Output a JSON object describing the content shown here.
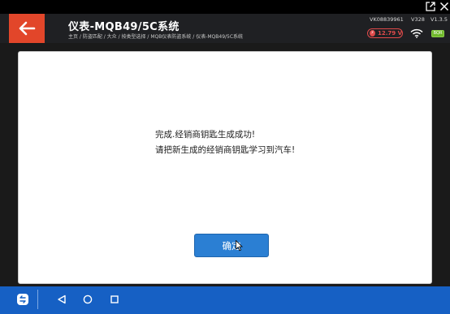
{
  "window": {
    "share_icon": "external-link-icon",
    "close_icon": "close-icon"
  },
  "header": {
    "title": "仪表-MQB49/5C系统",
    "breadcrumb": "主页 / 防盗匹配 / 大众 / 按类型选择 / MQB仪表防盗系统 / 仪表-MQB49/5C系统",
    "vin": "VK08839961",
    "model": "V328",
    "version": "V1.3.5",
    "voltage": "12.79 V",
    "battery": "BQR",
    "colors": {
      "accent": "#e2462a",
      "header_bg": "#1f2023",
      "voltage": "#e04a4a",
      "battery": "#6fb82b"
    }
  },
  "dialog": {
    "message_line1": "完成.经销商钥匙生成成功!",
    "message_line2": "请把新生成的经销商钥匙学习到汽车!",
    "ok_label": "确定",
    "colors": {
      "button": "#2b7fd3"
    }
  },
  "navbar": {
    "items": [
      "app-switch-icon",
      "back-triangle-icon",
      "home-circle-icon",
      "recents-square-icon"
    ],
    "colors": {
      "bg": "#1660c4"
    }
  }
}
